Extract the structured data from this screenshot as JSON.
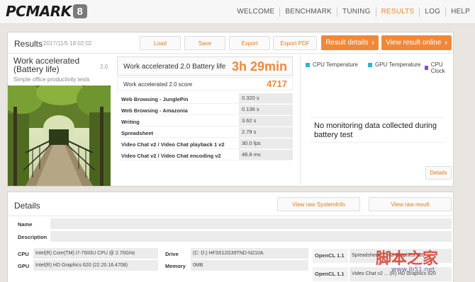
{
  "header": {
    "logo_text": "PCMARK",
    "logo_number": "8",
    "nav": [
      "WELCOME",
      "BENCHMARK",
      "TUNING",
      "RESULTS",
      "LOG",
      "HELP"
    ],
    "active_nav": "RESULTS"
  },
  "results": {
    "title": "Results",
    "date": "2017/11/5 18:02:02",
    "buttons": {
      "load": "Load",
      "save": "Save",
      "export": "Export",
      "export_pdf": "Export PDF"
    },
    "result_details": "Result details",
    "view_online": "View result online",
    "test_name_line1": "Work accelerated",
    "test_name_line2": "(Battery life)",
    "test_version": "2.0",
    "test_description": "Simple office productivity tests",
    "main_score_label": "Work accelerated 2.0 Battery life",
    "main_score_value": "3h 29min",
    "score_label": "Work accelerated 2.0 score",
    "score_value": "4717",
    "subtests": [
      {
        "name": "Web Browsing - JunglePin",
        "value": "0.320 s"
      },
      {
        "name": "Web Browsing - Amazonia",
        "value": "0.136 s"
      },
      {
        "name": "Writing",
        "value": "3.62 s"
      },
      {
        "name": "Spreadsheet",
        "value": "2.79 s"
      },
      {
        "name": "Video Chat v2 / Video Chat playback 1 v2",
        "value": "30.0 fps"
      },
      {
        "name": "Video Chat v2 / Video Chat encoding v2",
        "value": "48.8 ms"
      }
    ],
    "legend": [
      {
        "label": "CPU Temperature",
        "color": "#2fb3d6"
      },
      {
        "label": "GPU Temperature",
        "color": "#2fb3d6"
      },
      {
        "label": "CPU Clock",
        "color": "#8a4fc1"
      }
    ],
    "no_data_message": "No monitoring data collected during battery test",
    "details_button": "Details"
  },
  "details": {
    "title": "Details",
    "view_systeminfo": "View raw SystemInfo",
    "view_result": "View raw result",
    "name_label": "Name",
    "description_label": "Description",
    "cpu_label": "CPU",
    "cpu_value": "Intel(R) Core(TM) i7-7500U CPU @ 2.70GHz",
    "gpu_label": "GPU",
    "gpu_value": "Intel(R) HD Graphics 620 (22.20.16.4708)",
    "drive_label": "Drive",
    "drive_value": "(C: D:) HFS512G39TND-N210A",
    "memory_label": "Memory",
    "memory_value": "0MB",
    "opencl1_label": "OpenCL 1.1",
    "opencl1_value": "Spreadsheet ... HD Graphics 620",
    "opencl2_label": "OpenCL 1.1",
    "opencl2_value": "Video Chat v2 ... (R) HD Graphics 620"
  },
  "watermark": {
    "text": "脚本之家",
    "url": "www.jb51.net"
  }
}
